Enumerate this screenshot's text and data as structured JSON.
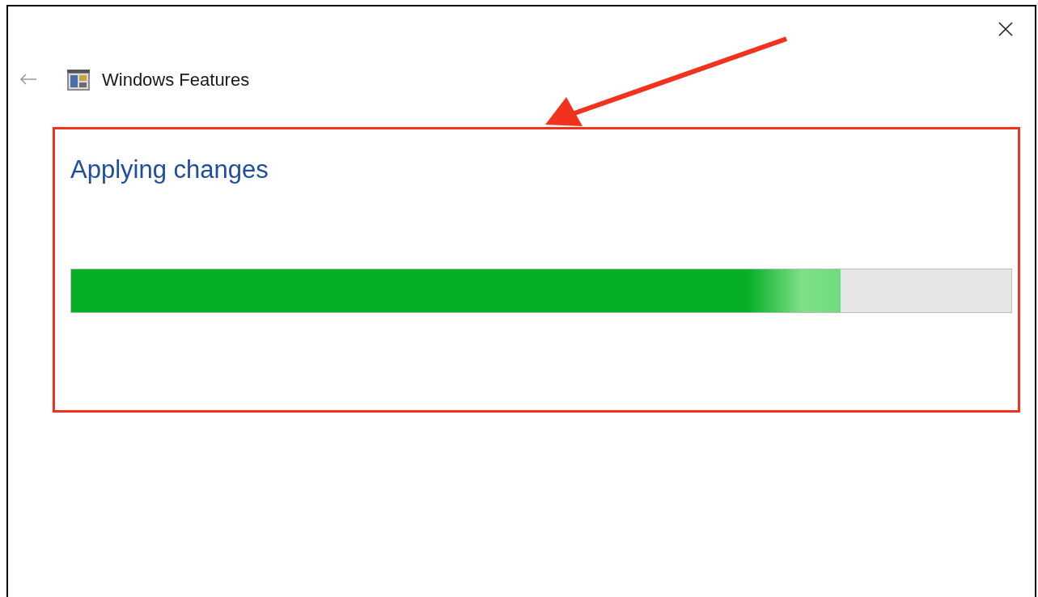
{
  "window": {
    "title": "Windows Features"
  },
  "heading": "Applying changes",
  "progress": {
    "level": 0.818
  }
}
